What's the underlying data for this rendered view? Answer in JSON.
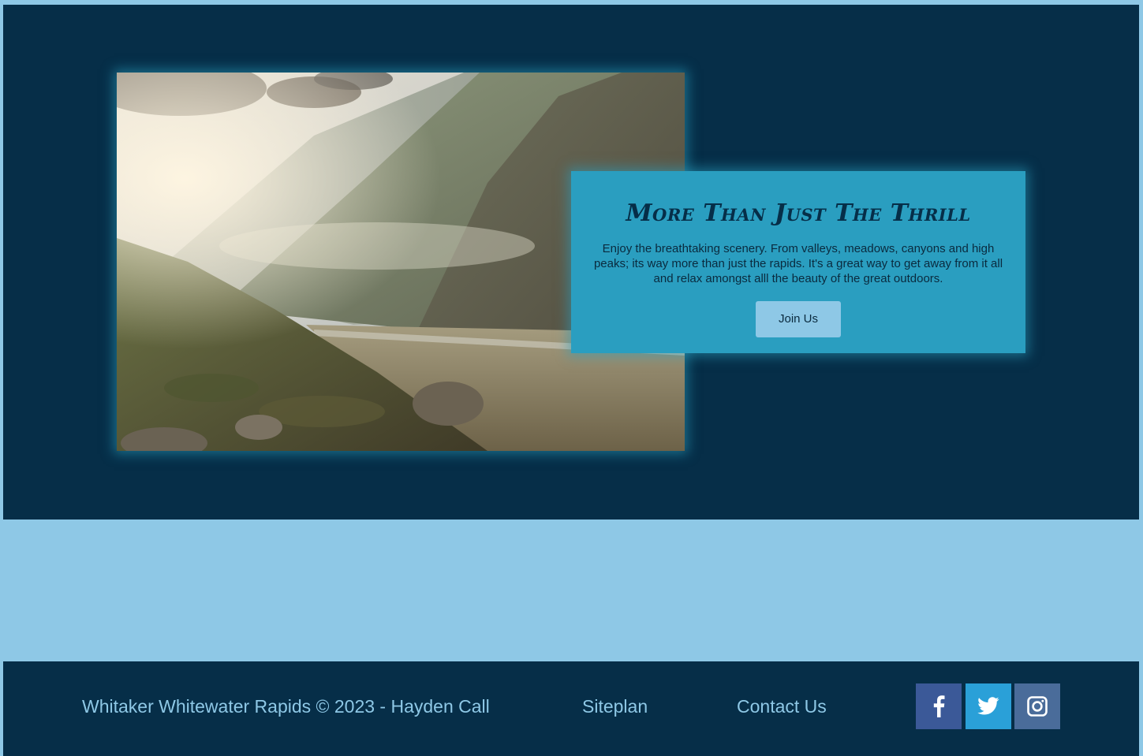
{
  "card": {
    "title": "More Than Just The Thrill",
    "text": "Enjoy the breathtaking scenery. From valleys, meadows, canyons and high peaks; its way more than just the rapids. It's a great way to get away from it all and relax amongst alll the beauty of the great outdoors.",
    "button_label": "Join Us"
  },
  "footer": {
    "copyright": "Whitaker Whitewater Rapids © 2023 - Hayden Call",
    "siteplan_label": "Siteplan",
    "contact_label": "Contact Us",
    "social": [
      {
        "icon": "facebook-icon",
        "color": "#3b5998"
      },
      {
        "icon": "twitter-icon",
        "color": "#2aa0d8"
      },
      {
        "icon": "instagram-icon",
        "color": "#4a6c9a"
      }
    ]
  },
  "colors": {
    "page_background": "#8ec8e6",
    "hero_background": "#062e48",
    "card_background": "#2a9ec0",
    "footer_background": "#062e48",
    "footer_text": "#8ec8e6"
  }
}
